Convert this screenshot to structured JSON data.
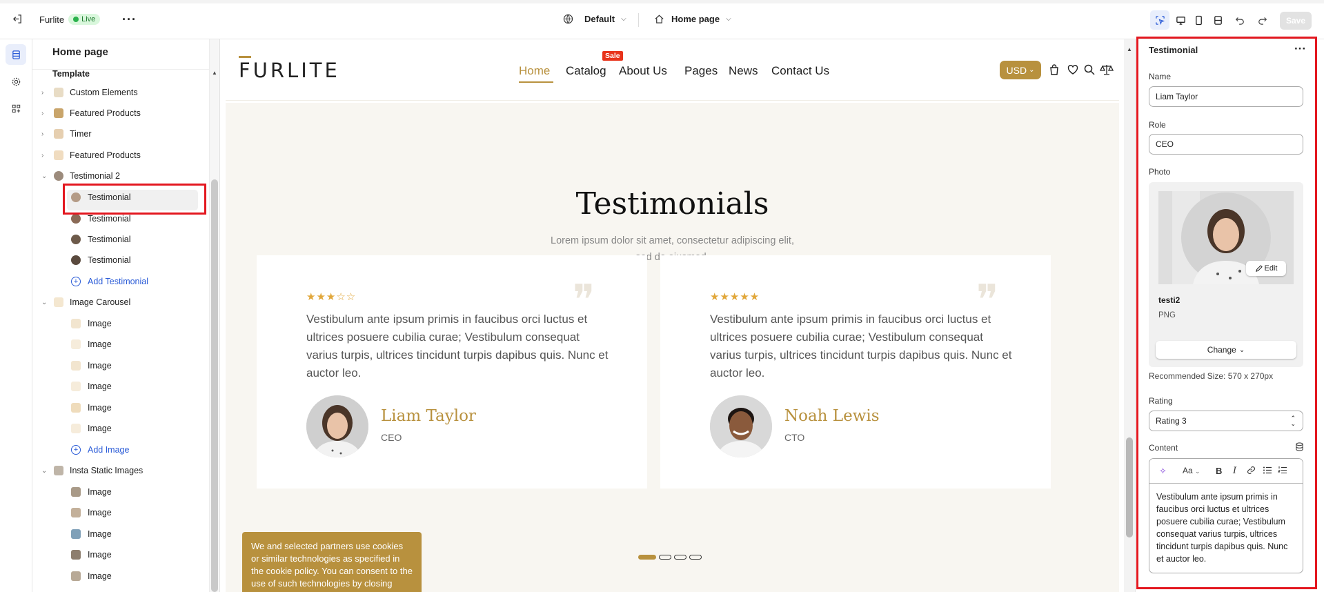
{
  "topbar": {
    "store_name": "Furlite",
    "live_label": "Live",
    "theme_label": "Default",
    "page_label": "Home page",
    "save_label": "Save"
  },
  "tree": {
    "title": "Home page",
    "group": "Template",
    "items": [
      {
        "label": "Custom Elements"
      },
      {
        "label": "Featured Products"
      },
      {
        "label": "Timer"
      },
      {
        "label": "Featured Products"
      },
      {
        "label": "Testimonial 2"
      },
      {
        "label": "Testimonial"
      },
      {
        "label": "Testimonial"
      },
      {
        "label": "Testimonial"
      },
      {
        "label": "Testimonial"
      },
      {
        "label": "Add Testimonial"
      },
      {
        "label": "Image Carousel"
      },
      {
        "label": "Image"
      },
      {
        "label": "Image"
      },
      {
        "label": "Image"
      },
      {
        "label": "Image"
      },
      {
        "label": "Image"
      },
      {
        "label": "Image"
      },
      {
        "label": "Add Image"
      },
      {
        "label": "Insta Static Images"
      },
      {
        "label": "Image"
      },
      {
        "label": "Image"
      },
      {
        "label": "Image"
      },
      {
        "label": "Image"
      },
      {
        "label": "Image"
      }
    ]
  },
  "preview": {
    "logo": "FURLITE",
    "nav": [
      "Home",
      "Catalog",
      "About Us",
      "Pages",
      "News",
      "Contact Us"
    ],
    "sale_badge": "Sale",
    "currency": "USD",
    "section_title": "Testimonials",
    "section_sub_1": "Lorem ipsum dolor sit amet, consectetur adipiscing elit,",
    "section_sub_2": "sed do eiusmod.",
    "cards": [
      {
        "stars": "★★★☆☆",
        "text": "Vestibulum ante ipsum primis in faucibus orci luctus et ultrices posuere cubilia curae; Vestibulum consequat varius turpis, ultrices tincidunt turpis dapibus quis. Nunc et auctor leo.",
        "name": "Liam Taylor",
        "role": "CEO",
        "rating": 3
      },
      {
        "stars": "★★★★★",
        "text": "Vestibulum ante ipsum primis in faucibus orci luctus et ultrices posuere cubilia curae; Vestibulum consequat varius turpis, ultrices tincidunt turpis dapibus quis. Nunc et auctor leo.",
        "name": "Noah Lewis",
        "role": "CTO",
        "rating": 5
      }
    ],
    "cookie_text": "We and selected partners use cookies or similar technologies as specified in the cookie policy. You can consent to the use of such technologies by closing"
  },
  "panel": {
    "title": "Testimonial",
    "name_label": "Name",
    "name_value": "Liam Taylor",
    "role_label": "Role",
    "role_value": "CEO",
    "photo_label": "Photo",
    "photo_edit": "Edit",
    "photo_file": "testi2",
    "photo_type": "PNG",
    "change_label": "Change",
    "recommended": "Recommended Size: 570 x 270px",
    "rating_label": "Rating",
    "rating_value": "Rating 3",
    "content_label": "Content",
    "content_font": "Aa",
    "content_text": "Vestibulum ante ipsum primis in faucibus orci luctus et ultrices posuere cubilia curae; Vestibulum consequat varius turpis, ultrices tincidunt turpis dapibus quis. Nunc et auctor leo."
  },
  "colors": {
    "accent": "#b8913e",
    "highlight": "#e3171f",
    "link": "#2a5bd7"
  }
}
